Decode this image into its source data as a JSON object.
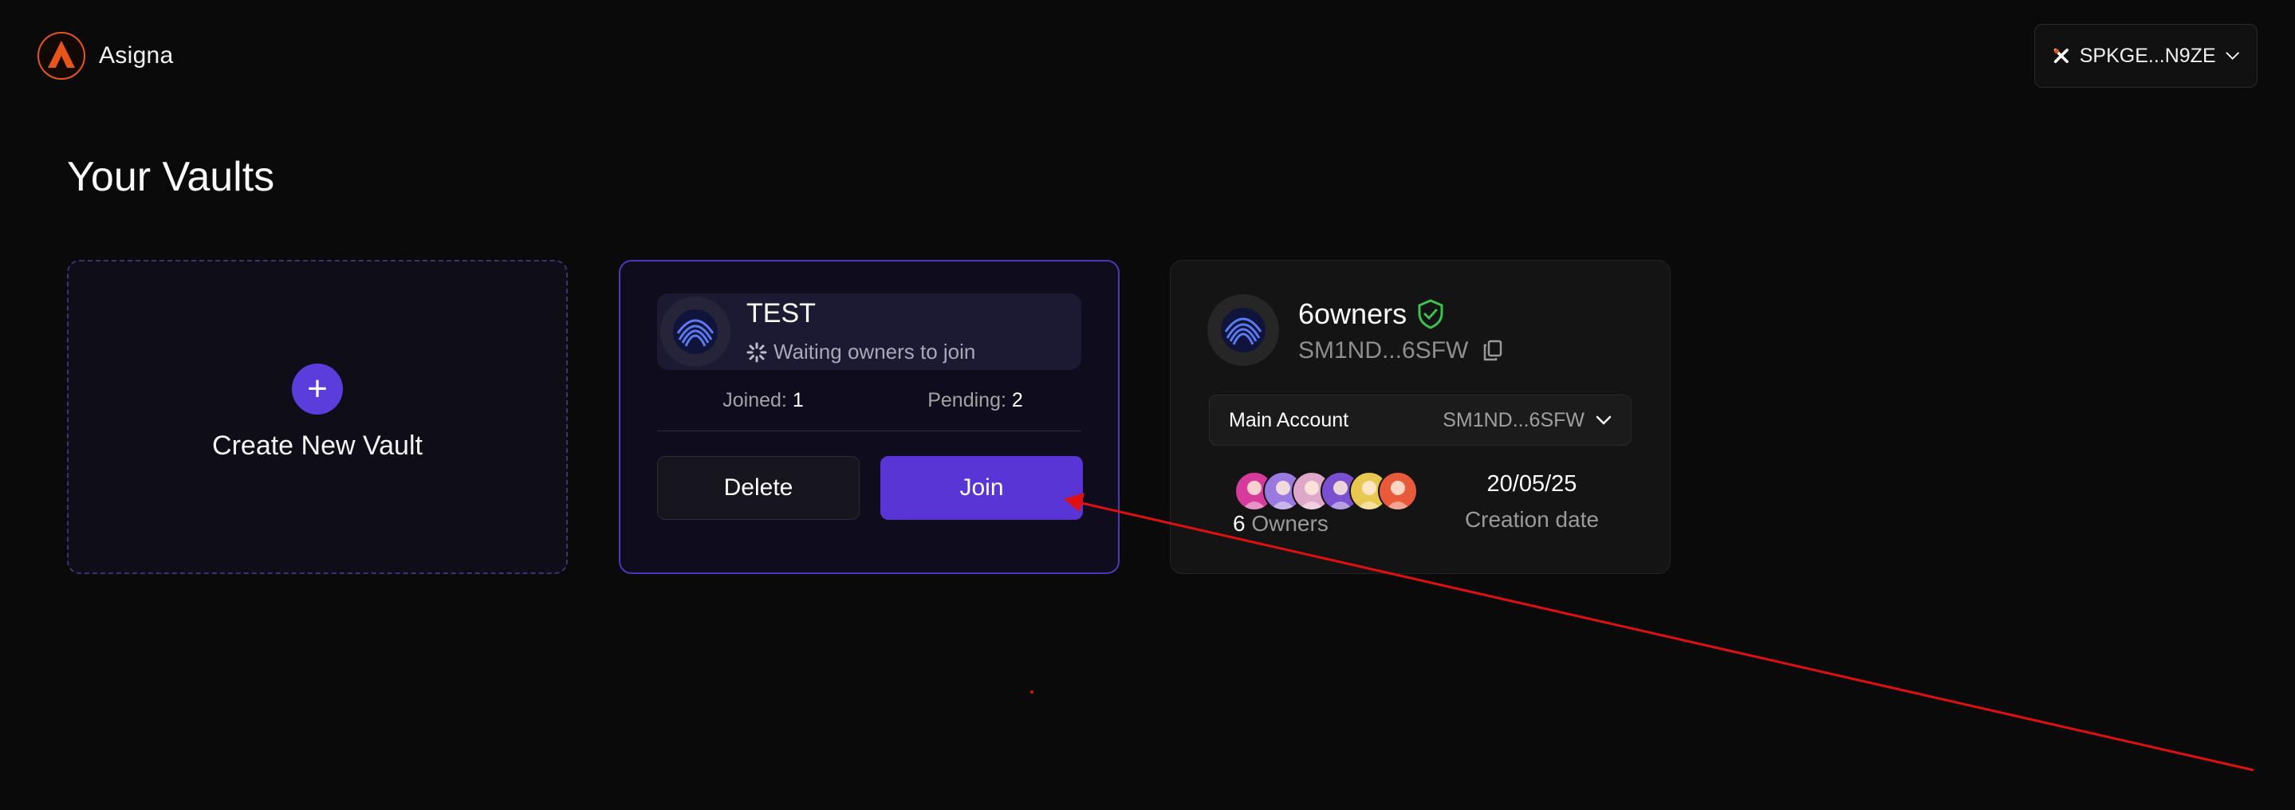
{
  "header": {
    "app_name": "Asigna",
    "wallet_address": "SPKGE...N9ZE",
    "brand_color": "#e8551b"
  },
  "page": {
    "title": "Your Vaults"
  },
  "create_card": {
    "label": "Create New Vault",
    "plus": "+"
  },
  "pending_vault": {
    "name": "TEST",
    "status": "Waiting owners to join",
    "joined_label": "Joined:",
    "joined_value": "1",
    "pending_label": "Pending:",
    "pending_value": "2",
    "delete_label": "Delete",
    "join_label": "Join",
    "accent_color": "#5a35d6"
  },
  "vault": {
    "name": "6owners",
    "address": "SM1ND...6SFW",
    "account_label": "Main Account",
    "account_address": "SM1ND...6SFW",
    "owners_count": "6",
    "owners_label": "Owners",
    "creation_date": "20/05/25",
    "creation_label": "Creation date",
    "verified_color": "#3fbf4b",
    "owner_colors": [
      "#d63a9a",
      "#9a7ae0",
      "#e0a8c8",
      "#7a4fd0",
      "#e8c850",
      "#e85a3a"
    ]
  }
}
